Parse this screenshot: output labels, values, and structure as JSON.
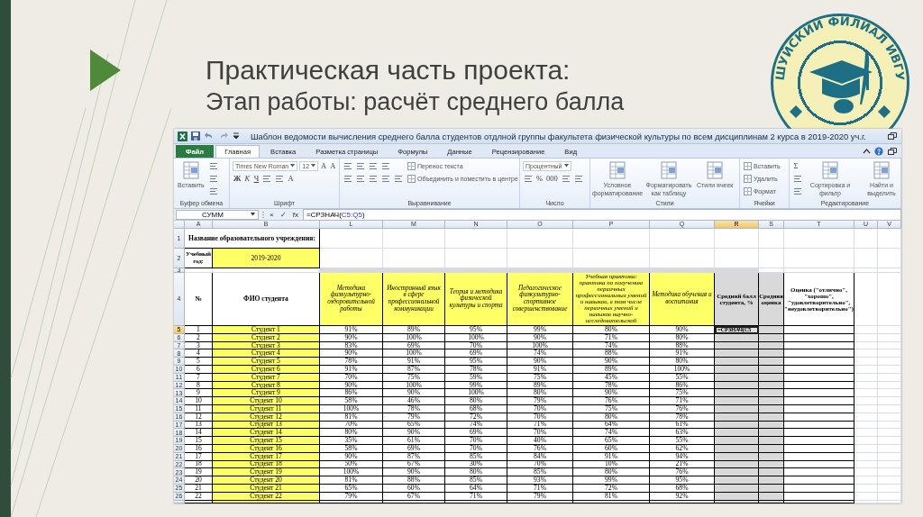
{
  "slide": {
    "title": "Практическая часть проекта:",
    "subtitle": "Этап работы: расчёт среднего балла"
  },
  "logo": {
    "text": "ШУЙСКИЙ ФИЛИАЛ ИВГУ"
  },
  "excel": {
    "window_title": "Шаблон ведомости вычисления среднего балла студентов отдлной группы факультета физической культуры по всем дисциплинам 2 курса в 2019-2020 уч.г.",
    "tabs": [
      {
        "label": "Файл",
        "kind": "file",
        "selected": false
      },
      {
        "label": "Главная",
        "kind": "tab",
        "selected": true
      },
      {
        "label": "Вставка",
        "kind": "tab",
        "selected": false
      },
      {
        "label": "Разметка страницы",
        "kind": "tab",
        "selected": false
      },
      {
        "label": "Формулы",
        "kind": "tab",
        "selected": false
      },
      {
        "label": "Данные",
        "kind": "tab",
        "selected": false
      },
      {
        "label": "Рецензирование",
        "kind": "tab",
        "selected": false
      },
      {
        "label": "Вид",
        "kind": "tab",
        "selected": false
      }
    ],
    "ribbon": [
      {
        "label": "Буфер обмена",
        "blocks": [
          {
            "kind": "large",
            "label": "Вставить"
          },
          {
            "kind": "stack",
            "lines": [
              [
                {
                  "kind": "icon"
                }
              ],
              [
                {
                  "kind": "icon"
                }
              ],
              [
                {
                  "kind": "icon"
                }
              ]
            ]
          }
        ]
      },
      {
        "label": "Шрифт",
        "blocks": [
          {
            "kind": "stack",
            "lines": [
              [
                {
                  "kind": "combo",
                  "label": "Times New Roman"
                },
                {
                  "kind": "combo",
                  "label": "12"
                },
                {
                  "kind": "glyph",
                  "label": "A"
                },
                {
                  "kind": "glyph",
                  "label": "A"
                }
              ],
              [
                {
                  "kind": "bold",
                  "label": "Ж"
                },
                {
                  "kind": "italic",
                  "label": "К"
                },
                {
                  "kind": "underline",
                  "label": "Ч"
                },
                {
                  "kind": "icon"
                },
                {
                  "kind": "icon"
                },
                {
                  "kind": "glyph",
                  "label": "A"
                }
              ]
            ]
          }
        ]
      },
      {
        "label": "Выравнивание",
        "blocks": [
          {
            "kind": "stack",
            "lines": [
              [
                {
                  "kind": "icon"
                },
                {
                  "kind": "icon"
                },
                {
                  "kind": "icon"
                },
                {
                  "kind": "icon"
                }
              ],
              [
                {
                  "kind": "icon"
                },
                {
                  "kind": "icon"
                },
                {
                  "kind": "icon"
                },
                {
                  "kind": "icon"
                },
                {
                  "kind": "icon"
                }
              ]
            ]
          },
          {
            "kind": "stack",
            "lines": [
              [
                {
                  "kind": "small",
                  "label": "Перенос текста"
                }
              ],
              [
                {
                  "kind": "small",
                  "label": "Объединить и поместить в центре"
                }
              ]
            ]
          }
        ]
      },
      {
        "label": "Число",
        "blocks": [
          {
            "kind": "stack",
            "lines": [
              [
                {
                  "kind": "combo",
                  "label": "Процентный"
                }
              ],
              [
                {
                  "kind": "icon"
                },
                {
                  "kind": "glyph",
                  "label": "%"
                },
                {
                  "kind": "glyph",
                  "label": "000"
                },
                {
                  "kind": "icon"
                },
                {
                  "kind": "icon"
                }
              ]
            ]
          }
        ]
      },
      {
        "label": "Стили",
        "blocks": [
          {
            "kind": "large",
            "label": "Условное форматирование"
          },
          {
            "kind": "large",
            "label": "Форматировать как таблицу"
          },
          {
            "kind": "large",
            "label": "Стили ячеек"
          }
        ]
      },
      {
        "label": "Ячейки",
        "blocks": [
          {
            "kind": "stack",
            "lines": [
              [
                {
                  "kind": "small",
                  "label": "Вставить"
                }
              ],
              [
                {
                  "kind": "small",
                  "label": "Удалить"
                }
              ],
              [
                {
                  "kind": "small",
                  "label": "Формат"
                }
              ]
            ]
          }
        ]
      },
      {
        "label": "Редактирование",
        "blocks": [
          {
            "kind": "stack",
            "lines": [
              [
                {
                  "kind": "glyph",
                  "label": "Σ"
                }
              ],
              [
                {
                  "kind": "icon"
                }
              ],
              [
                {
                  "kind": "icon"
                }
              ]
            ]
          },
          {
            "kind": "large",
            "label": "Сортировка и фильтр"
          },
          {
            "kind": "large",
            "label": "Найти и выделить"
          }
        ]
      }
    ],
    "formula_bar": {
      "name_box": "СУММ",
      "buttons": [
        "×",
        "✓",
        "fx"
      ],
      "formula_start": "=СРЗНАЧ(",
      "formula_reference": "C5:Q5",
      "formula_end": ")"
    },
    "sheet": {
      "columns": [
        {
          "label": "A",
          "selected": false
        },
        {
          "label": "B",
          "selected": false
        },
        {
          "label": "L",
          "selected": false
        },
        {
          "label": "M",
          "selected": false
        },
        {
          "label": "N",
          "selected": false
        },
        {
          "label": "O",
          "selected": false
        },
        {
          "label": "P",
          "selected": false
        },
        {
          "label": "Q",
          "selected": false
        },
        {
          "label": "R",
          "selected": true
        },
        {
          "label": "S",
          "selected": false
        },
        {
          "label": "T",
          "selected": false
        },
        {
          "label": "U",
          "selected": false
        },
        {
          "label": "V",
          "selected": false
        }
      ],
      "top_rows": [
        {
          "label": "1",
          "selected": false
        },
        {
          "label": "2",
          "selected": false
        },
        {
          "label": "3",
          "selected": false
        },
        {
          "label": "4",
          "selected": false
        }
      ],
      "institution_label": "Название образовательного учреждения:",
      "year_label": "Учебный год:",
      "year": "2019-2020",
      "header": {
        "number": "№",
        "name": "ФИО студента",
        "subjects": [
          "Методика физкультурно-оздоровительной работы",
          "Иностранный язык в сфере профессиональной коммуникации",
          "Теория и методика физической культуры и спорта",
          "Педагогическое физкультурно-спортивное совершенствование",
          "Учебная практика: практика по получению первичных профессиональных умений и навыков, в том числе первичных умений и навыков научно-исследовательской",
          "Методика обучения и воспитания"
        ],
        "average": "Средний балл студента, %",
        "grade": "Средняя оценка",
        "scale": "Оценка (\"отлично\", \"хорошо\", \"удовлетворительно\", \"неудовлетворительно\")"
      },
      "rows": [
        {
          "row": "5",
          "selected": true,
          "number": "1",
          "name": "Студент 1",
          "scores": [
            "91%",
            "89%",
            "95%",
            "99%",
            "80%",
            "90%"
          ],
          "average": "=СРЗНАЧ(C5"
        },
        {
          "row": "6",
          "selected": false,
          "number": "2",
          "name": "Студент 2",
          "scores": [
            "90%",
            "100%",
            "100%",
            "90%",
            "71%",
            "80%"
          ]
        },
        {
          "row": "7",
          "selected": false,
          "number": "3",
          "name": "Студент 3",
          "scores": [
            "83%",
            "69%",
            "70%",
            "100%",
            "74%",
            "88%"
          ]
        },
        {
          "row": "8",
          "selected": false,
          "number": "4",
          "name": "Студент 4",
          "scores": [
            "90%",
            "100%",
            "69%",
            "74%",
            "88%",
            "91%"
          ]
        },
        {
          "row": "9",
          "selected": false,
          "number": "5",
          "name": "Студент 5",
          "scores": [
            "78%",
            "91%",
            "95%",
            "90%",
            "90%",
            "80%"
          ]
        },
        {
          "row": "10",
          "selected": false,
          "number": "6",
          "name": "Студент 6",
          "scores": [
            "91%",
            "87%",
            "78%",
            "91%",
            "89%",
            "100%"
          ]
        },
        {
          "row": "11",
          "selected": false,
          "number": "7",
          "name": "Студент 7",
          "scores": [
            "70%",
            "75%",
            "59%",
            "75%",
            "45%",
            "55%"
          ]
        },
        {
          "row": "12",
          "selected": false,
          "number": "8",
          "name": "Студент 8",
          "scores": [
            "90%",
            "100%",
            "99%",
            "89%",
            "78%",
            "86%"
          ]
        },
        {
          "row": "13",
          "selected": false,
          "number": "9",
          "name": "Студент 9",
          "scores": [
            "86%",
            "90%",
            "100%",
            "80%",
            "90%",
            "75%"
          ]
        },
        {
          "row": "14",
          "selected": false,
          "number": "10",
          "name": "Студент 10",
          "scores": [
            "58%",
            "46%",
            "80%",
            "79%",
            "76%",
            "71%"
          ]
        },
        {
          "row": "15",
          "selected": false,
          "number": "11",
          "name": "Студент 11",
          "scores": [
            "100%",
            "78%",
            "68%",
            "70%",
            "75%",
            "76%"
          ]
        },
        {
          "row": "16",
          "selected": false,
          "number": "12",
          "name": "Студент 12",
          "scores": [
            "81%",
            "79%",
            "72%",
            "70%",
            "80%",
            "78%"
          ]
        },
        {
          "row": "17",
          "selected": false,
          "number": "13",
          "name": "Студент 13",
          "scores": [
            "70%",
            "65%",
            "74%",
            "71%",
            "64%",
            "61%"
          ]
        },
        {
          "row": "18",
          "selected": false,
          "number": "14",
          "name": "Студент 14",
          "scores": [
            "80%",
            "90%",
            "69%",
            "70%",
            "74%",
            "63%"
          ]
        },
        {
          "row": "19",
          "selected": false,
          "number": "15",
          "name": "Студент 15",
          "scores": [
            "35%",
            "61%",
            "70%",
            "40%",
            "65%",
            "55%"
          ]
        },
        {
          "row": "20",
          "selected": false,
          "number": "16",
          "name": "Студент 16",
          "scores": [
            "58%",
            "69%",
            "70%",
            "76%",
            "60%",
            "62%"
          ]
        },
        {
          "row": "21",
          "selected": false,
          "number": "17",
          "name": "Студент 17",
          "scores": [
            "90%",
            "87%",
            "85%",
            "84%",
            "91%",
            "94%"
          ]
        },
        {
          "row": "22",
          "selected": false,
          "number": "18",
          "name": "Студент 18",
          "scores": [
            "50%",
            "67%",
            "30%",
            "70%",
            "10%",
            "21%"
          ]
        },
        {
          "row": "23",
          "selected": false,
          "number": "19",
          "name": "Студент 19",
          "scores": [
            "100%",
            "90%",
            "80%",
            "85%",
            "80%",
            "76%"
          ]
        },
        {
          "row": "24",
          "selected": false,
          "number": "20",
          "name": "Студент 20",
          "scores": [
            "81%",
            "88%",
            "85%",
            "93%",
            "99%",
            "95%"
          ]
        },
        {
          "row": "25",
          "selected": false,
          "number": "21",
          "name": "Студент 21",
          "scores": [
            "65%",
            "60%",
            "64%",
            "71%",
            "72%",
            "68%"
          ]
        },
        {
          "row": "26",
          "selected": false,
          "number": "22",
          "name": "Студент 22",
          "scores": [
            "79%",
            "67%",
            "71%",
            "79%",
            "81%",
            "92%"
          ]
        }
      ]
    }
  }
}
